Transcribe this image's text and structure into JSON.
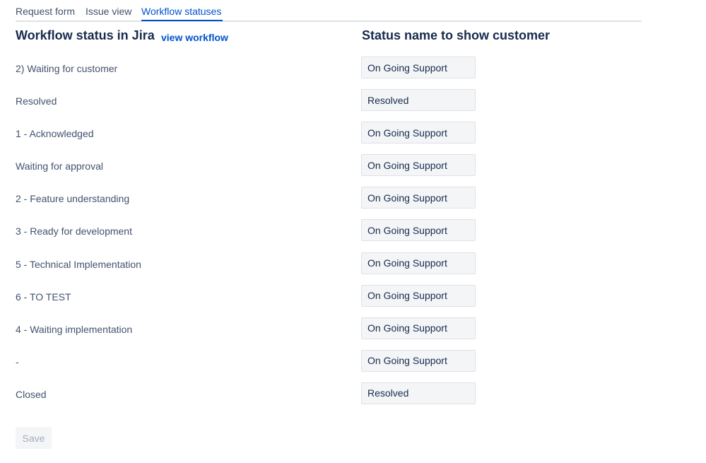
{
  "tabs": [
    {
      "label": "Request form"
    },
    {
      "label": "Issue view"
    },
    {
      "label": "Workflow statuses",
      "active": true
    }
  ],
  "headings": {
    "left": "Workflow status in Jira",
    "view_workflow_link": "view workflow",
    "right": "Status name to show customer"
  },
  "rows": [
    {
      "status": "2) Waiting for customer",
      "customer_name": "On Going Support"
    },
    {
      "status": "Resolved",
      "customer_name": "Resolved"
    },
    {
      "status": "1 - Acknowledged",
      "customer_name": "On Going Support"
    },
    {
      "status": "Waiting for approval",
      "customer_name": "On Going Support"
    },
    {
      "status": "2 - Feature understanding",
      "customer_name": "On Going Support"
    },
    {
      "status": "3 - Ready for development",
      "customer_name": "On Going Support"
    },
    {
      "status": "5 - Technical Implementation",
      "customer_name": "On Going Support"
    },
    {
      "status": "6 - TO TEST",
      "customer_name": "On Going Support"
    },
    {
      "status": "4 - Waiting implementation",
      "customer_name": "On Going Support"
    },
    {
      "status": "-",
      "customer_name": "On Going Support"
    },
    {
      "status": "Closed",
      "customer_name": "Resolved"
    }
  ],
  "save_button": {
    "label": "Save",
    "disabled": true
  },
  "colors": {
    "accent": "#0052cc",
    "text": "#172b4d",
    "muted_text": "#42526e",
    "input_bg": "#f4f5f7",
    "divider": "#dfe1e6"
  }
}
